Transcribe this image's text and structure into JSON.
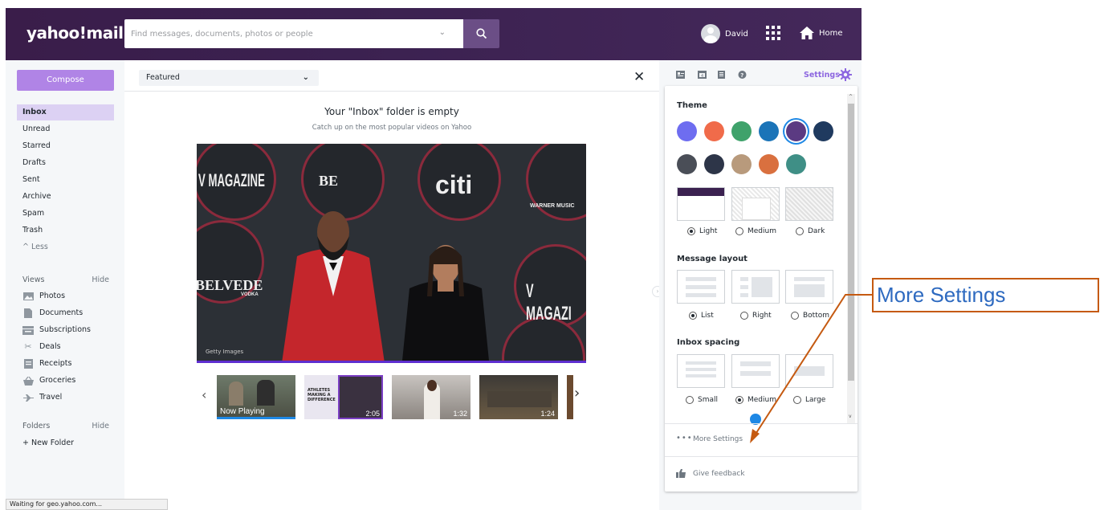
{
  "header": {
    "logo": "yahoo!mail",
    "search_placeholder": "Find messages, documents, photos or people",
    "user_name": "David",
    "home_label": "Home"
  },
  "sidebar": {
    "compose": "Compose",
    "folders": [
      {
        "label": "Inbox",
        "active": true
      },
      {
        "label": "Unread"
      },
      {
        "label": "Starred"
      },
      {
        "label": "Drafts"
      },
      {
        "label": "Sent"
      },
      {
        "label": "Archive"
      },
      {
        "label": "Spam"
      },
      {
        "label": "Trash"
      }
    ],
    "less": "^ Less",
    "views_title": "Views",
    "views_hide": "Hide",
    "views": [
      {
        "label": "Photos",
        "icon": "photos-icon"
      },
      {
        "label": "Documents",
        "icon": "document-icon"
      },
      {
        "label": "Subscriptions",
        "icon": "subscriptions-icon"
      },
      {
        "label": "Deals",
        "icon": "scissors-icon"
      },
      {
        "label": "Receipts",
        "icon": "receipt-icon"
      },
      {
        "label": "Groceries",
        "icon": "basket-icon"
      },
      {
        "label": "Travel",
        "icon": "plane-icon"
      }
    ],
    "folders_title": "Folders",
    "folders_hide": "Hide",
    "new_folder": "+ New Folder"
  },
  "main": {
    "featured_label": "Featured",
    "empty_title": "Your \"Inbox\" folder is empty",
    "empty_subtitle": "Catch up on the most popular videos on Yahoo",
    "video_text": {
      "sign_1": "V MAGAZINE",
      "sign_2": "BE",
      "sign_3": "citi",
      "sign_4": "WARNER MUSIC",
      "sign_5": "BELVEDE",
      "sign_6": "VODKA",
      "sign_7": "V MAGAZI",
      "credit": "Getty Images"
    },
    "thumbnails": [
      {
        "label": "Now Playing",
        "duration": ""
      },
      {
        "label": "ATHLETES MAKING A DIFFERENCE",
        "duration": "2:05"
      },
      {
        "label": "",
        "duration": "1:32"
      },
      {
        "label": "",
        "duration": "1:24"
      }
    ]
  },
  "settings": {
    "link": "Settings",
    "theme_heading": "Theme",
    "theme_colors_row1": [
      "#6e6df0",
      "#f06b4a",
      "#3fa26b",
      "#1b74b8",
      "#5b3a82",
      "#1f3a5f"
    ],
    "theme_colors_row2": [
      "#4a4e57",
      "#2d3548",
      "#b89a7c",
      "#d9703f",
      "#3f8f86"
    ],
    "selected_theme_index": 4,
    "contrast_options": [
      {
        "label": "Light",
        "selected": true
      },
      {
        "label": "Medium",
        "selected": false
      },
      {
        "label": "Dark",
        "selected": false
      }
    ],
    "layout_heading": "Message layout",
    "layout_options": [
      {
        "label": "List",
        "selected": true
      },
      {
        "label": "Right",
        "selected": false
      },
      {
        "label": "Bottom",
        "selected": false
      }
    ],
    "spacing_heading": "Inbox spacing",
    "spacing_options": [
      {
        "label": "Small",
        "selected": false
      },
      {
        "label": "Medium",
        "selected": true
      },
      {
        "label": "Large",
        "selected": false
      }
    ],
    "more_settings": "More Settings",
    "give_feedback": "Give feedback"
  },
  "status_bar": "Waiting for geo.yahoo.com...",
  "annotation": {
    "callout_label": "More Settings",
    "callout_color": "#c55a11",
    "text_color": "#2e6ac0"
  },
  "colors": {
    "header": "#3b2150",
    "compose": "#b084e6",
    "accent": "#8d67e0",
    "active_folder": "#dcd1f3"
  }
}
